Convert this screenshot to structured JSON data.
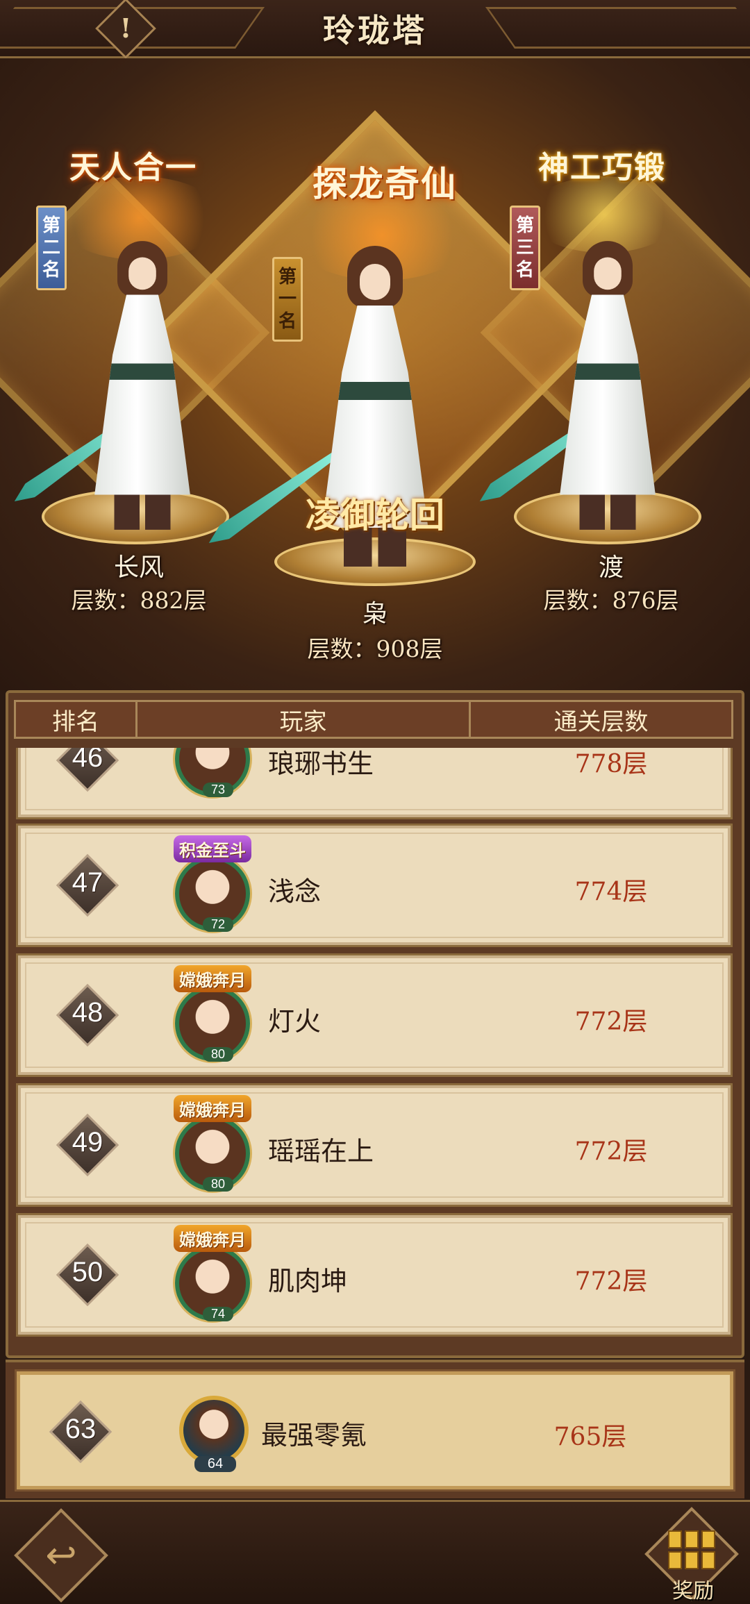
{
  "header": {
    "title": "玲珑塔",
    "info_icon": "!"
  },
  "podium": {
    "second": {
      "honor": "天人合一",
      "rank_label": "第二名",
      "name": "长风",
      "floor": "层数：882层"
    },
    "first": {
      "honor": "探龙奇仙",
      "rank_label": "第一名",
      "title": "凌御轮回",
      "name": "枭",
      "floor": "层数：908层"
    },
    "third": {
      "honor": "神工巧锻",
      "rank_label": "第三名",
      "name": "渡",
      "floor": "层数：876层"
    }
  },
  "table": {
    "headers": {
      "rank": "排名",
      "player": "玩家",
      "floor": "通关层数"
    },
    "rows": [
      {
        "rank": "46",
        "name": "琅琊书生",
        "level": "73",
        "badge": "",
        "floor": "778层"
      },
      {
        "rank": "47",
        "name": "浅念",
        "level": "72",
        "badge": "积金至斗",
        "floor": "774层"
      },
      {
        "rank": "48",
        "name": "灯火",
        "level": "80",
        "badge": "嫦娥奔月",
        "floor": "772层"
      },
      {
        "rank": "49",
        "name": "瑶瑶在上",
        "level": "80",
        "badge": "嫦娥奔月",
        "floor": "772层"
      },
      {
        "rank": "50",
        "name": "肌肉坤",
        "level": "74",
        "badge": "嫦娥奔月",
        "floor": "772层"
      }
    ]
  },
  "my_rank": {
    "rank": "63",
    "name": "最强零氪",
    "level": "64",
    "floor": "765层"
  },
  "footer": {
    "back_icon": "↩",
    "reward_label": "奖励"
  }
}
